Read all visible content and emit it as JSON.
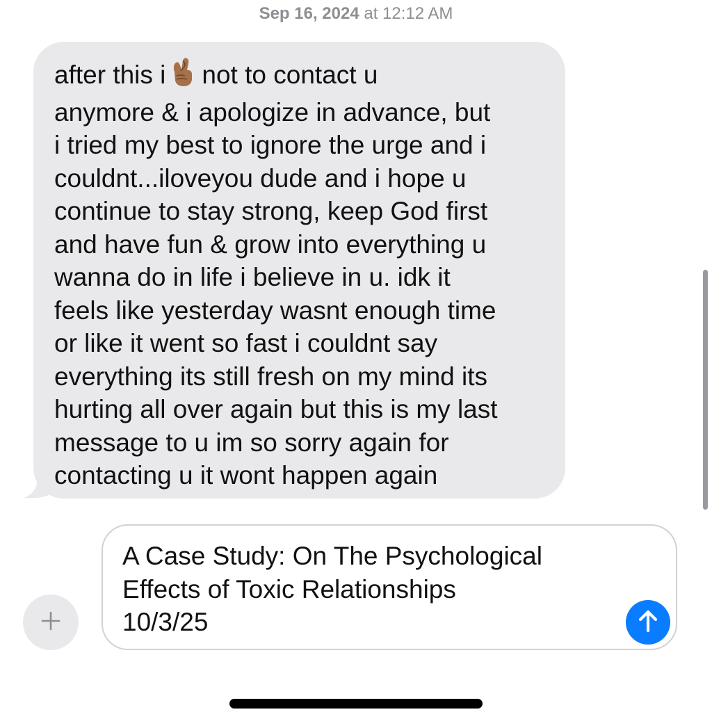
{
  "timestamp": {
    "date": "Sep 16, 2024",
    "time": " at 12:12 AM"
  },
  "message": {
    "first_line_before_emoji": "after this i",
    "emoji_icon": "crossed-fingers-emoji",
    "first_line_after_emoji": "not to contact u",
    "lines": [
      "anymore & i apologize in advance, but",
      "i tried my best to ignore the urge and i",
      "couldnt...iloveyou dude and i hope u",
      "continue to stay strong, keep God first",
      "and have fun & grow into everything u",
      "wanna do in life i believe in u. idk it",
      "feels like yesterday wasnt enough time",
      "or like it went so fast i couldnt say",
      "everything its still fresh on my mind its",
      "hurting all over again but this is my last",
      "message to u im so sorry again for",
      "contacting u it wont happen again"
    ]
  },
  "composer": {
    "lines": [
      "A Case Study: On The Psychological",
      "Effects of Toxic Relationships",
      "10/3/25"
    ],
    "plus_icon": "plus-icon",
    "send_icon": "arrow-up-icon"
  },
  "colors": {
    "bubble": "#e9e9eb",
    "send": "#0a7cff",
    "timestamp": "#8e8e93"
  }
}
